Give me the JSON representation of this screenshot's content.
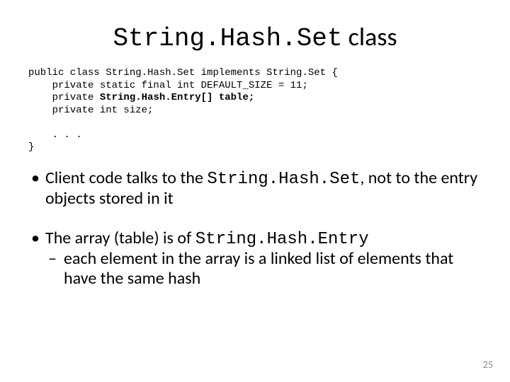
{
  "title": {
    "mono": "String.Hash.Set",
    "rest": " class"
  },
  "code": {
    "l1a": "public class String.Hash.Set implements String.Set {",
    "l2a": "    private static final int DEFAULT_SIZE = 11;",
    "l3a": "    private ",
    "l3b": "String.Hash.Entry[] table;",
    "l4a": "    private int size;",
    "blank": "",
    "l5a": "    . . .",
    "l6a": "}"
  },
  "bullets": {
    "b1a": "Client code talks to the ",
    "b1mono": "String.Hash.Set",
    "b1b": ", not to the entry objects stored in it",
    "b2a": "The array (table) is of ",
    "b2mono": "String.Hash.Entry",
    "b2sub": "each element in the array is a linked list of elements that have the same hash"
  },
  "pagenum": "25"
}
